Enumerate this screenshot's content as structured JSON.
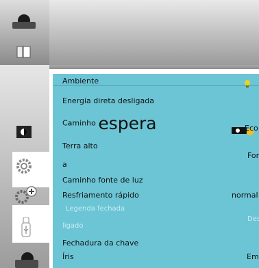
{
  "colors": {
    "panel": "#6cc5d5",
    "accent_bulb": "#e8d22a",
    "dim_text": "#c5ecf2"
  },
  "rail": {
    "icons": [
      "display-icon",
      "keystone-icon",
      "brightness-icon",
      "settings-icon",
      "advanced-settings-icon",
      "usb-icon",
      "info-icon"
    ]
  },
  "panel": {
    "title": "Ambiente",
    "rows": [
      {
        "label": "Energia direta desligada",
        "value": ""
      },
      {
        "label": "Caminho",
        "label_big": "espera",
        "value": "Eco"
      },
      {
        "label": "Terra alto",
        "value": ""
      },
      {
        "label": "a",
        "value": "For"
      },
      {
        "label": "Caminho fonte de luz",
        "value": ""
      },
      {
        "label": "Resfriamento rápido",
        "value": "normal"
      },
      {
        "label": "Legenda fechada",
        "value": "",
        "dim": true
      },
      {
        "label": "ligado",
        "value": "Des",
        "dim": true
      },
      {
        "label": "Fechadura da chave",
        "value": ""
      },
      {
        "label": "Íris",
        "value": "Em"
      }
    ]
  }
}
